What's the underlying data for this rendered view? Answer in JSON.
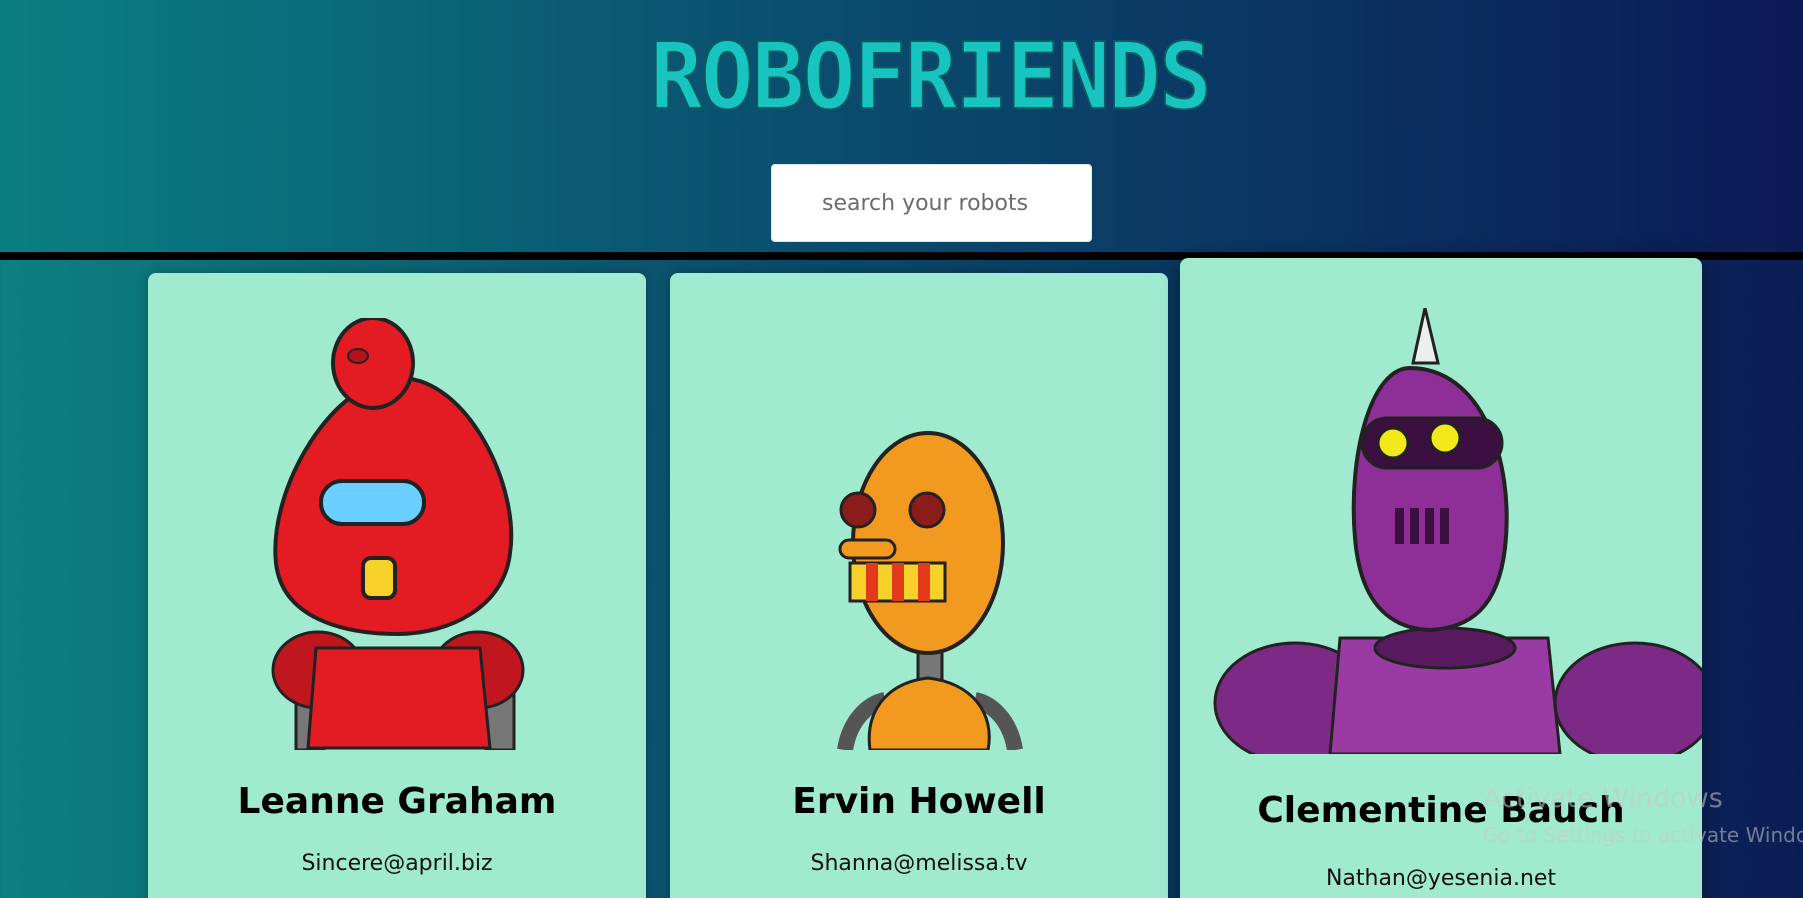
{
  "app": {
    "title": "ROBOFRIENDS"
  },
  "search": {
    "placeholder": "search your robots",
    "value": ""
  },
  "cards": [
    {
      "name": "Leanne Graham",
      "email": "Sincere@april.biz",
      "robot_icon": "red-robot-icon"
    },
    {
      "name": "Ervin Howell",
      "email": "Shanna@melissa.tv",
      "robot_icon": "orange-robot-icon"
    },
    {
      "name": "Clementine Bauch",
      "email": "Nathan@yesenia.net",
      "robot_icon": "purple-robot-icon"
    }
  ],
  "watermark": {
    "title": "Activate Windows",
    "subtitle": "Go to Settings to activate Windows."
  },
  "colors": {
    "title": "#17c4c0",
    "card": "#a0ead0",
    "divider": "#000000"
  }
}
